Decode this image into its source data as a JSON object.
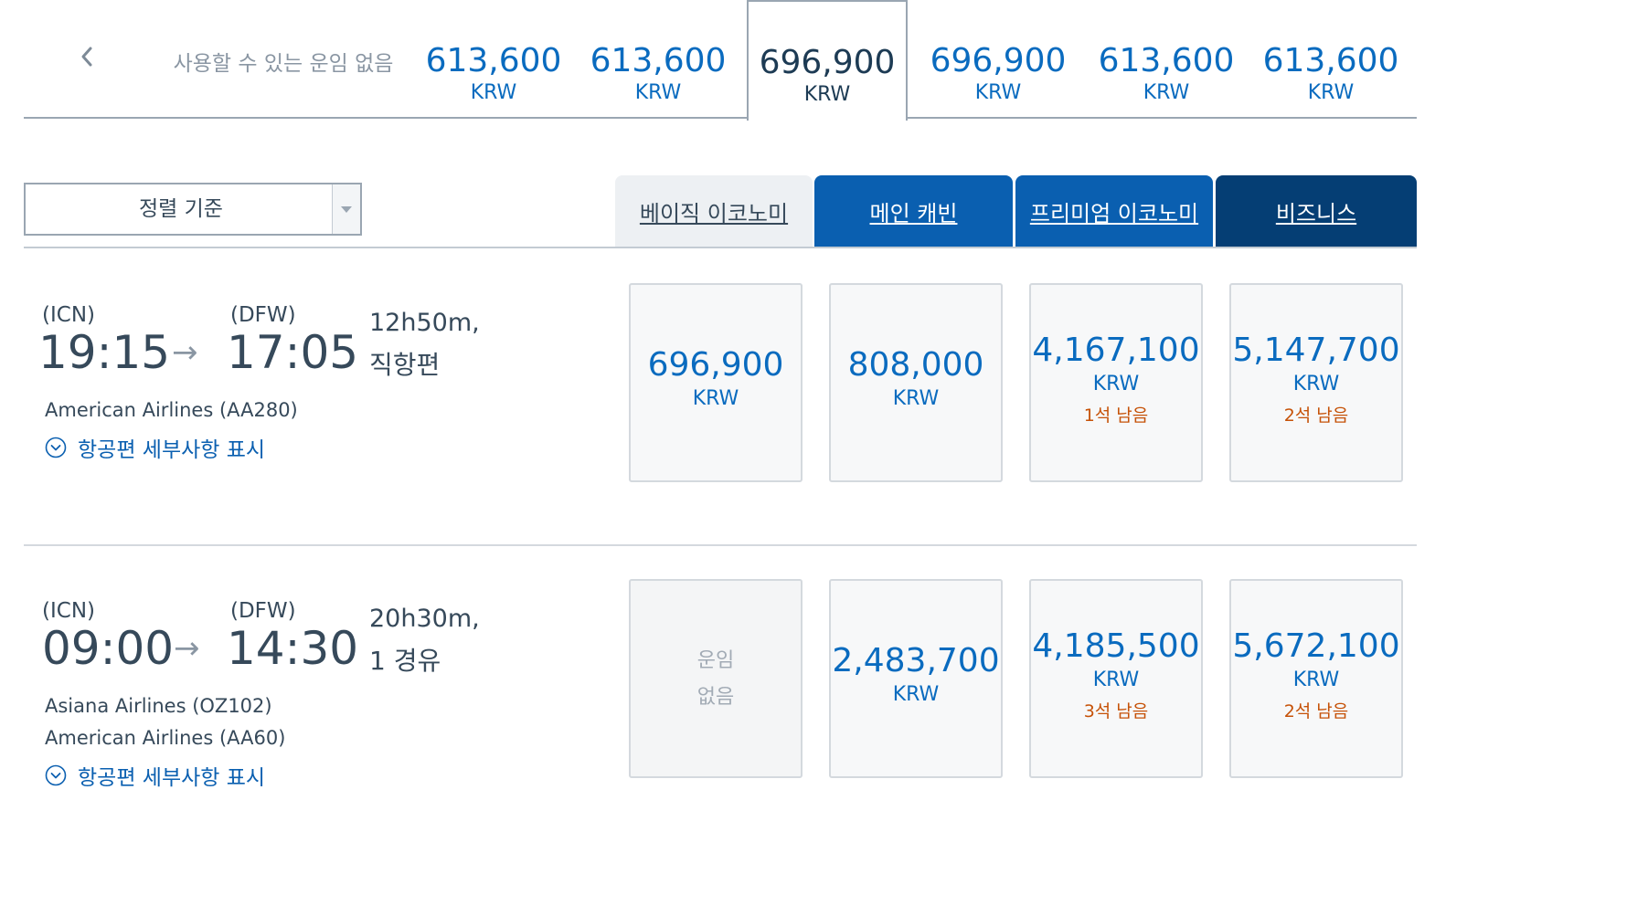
{
  "date_strip": {
    "no_fare_label": "사용할 수 있는 운임 없음",
    "tabs": [
      {
        "amount": "613,600",
        "currency": "KRW",
        "selected": false
      },
      {
        "amount": "613,600",
        "currency": "KRW",
        "selected": false
      },
      {
        "amount": "696,900",
        "currency": "KRW",
        "selected": true
      },
      {
        "amount": "696,900",
        "currency": "KRW",
        "selected": false
      },
      {
        "amount": "613,600",
        "currency": "KRW",
        "selected": false
      },
      {
        "amount": "613,600",
        "currency": "KRW",
        "selected": false
      }
    ]
  },
  "sort": {
    "label": "정렬 기준"
  },
  "cabins": {
    "basic": "베이직 이코노미",
    "main": "메인 캐빈",
    "premium": "프리미엄 이코노미",
    "business": "비즈니스"
  },
  "flights": [
    {
      "origin_code": "(ICN)",
      "dest_code": "(DFW)",
      "depart": "19:15",
      "arrive": "17:05",
      "duration": "12h50m,",
      "stops": "직항편",
      "carriers": [
        "American Airlines (AA280)"
      ],
      "details_label": "항공편 세부사항 표시",
      "fares": [
        {
          "amount": "696,900",
          "currency": "KRW",
          "seats": ""
        },
        {
          "amount": "808,000",
          "currency": "KRW",
          "seats": ""
        },
        {
          "amount": "4,167,100",
          "currency": "KRW",
          "seats": "1석 남음"
        },
        {
          "amount": "5,147,700",
          "currency": "KRW",
          "seats": "2석 남음"
        }
      ]
    },
    {
      "origin_code": "(ICN)",
      "dest_code": "(DFW)",
      "depart": "09:00",
      "arrive": "14:30",
      "duration": "20h30m,",
      "stops": "1 경유",
      "carriers": [
        "Asiana Airlines (OZ102)",
        "American Airlines (AA60)"
      ],
      "details_label": "항공편 세부사항 표시",
      "fares": [
        {
          "unavailable_line1": "운임",
          "unavailable_line2": "없음"
        },
        {
          "amount": "2,483,700",
          "currency": "KRW",
          "seats": ""
        },
        {
          "amount": "4,185,500",
          "currency": "KRW",
          "seats": "3석 남음"
        },
        {
          "amount": "5,672,100",
          "currency": "KRW",
          "seats": "2석 남음"
        }
      ]
    }
  ],
  "colors": {
    "link_blue": "#0a6bbf",
    "cabin_blue": "#0a5fb0",
    "business_navy": "#053e74",
    "seats_orange": "#c65208"
  }
}
